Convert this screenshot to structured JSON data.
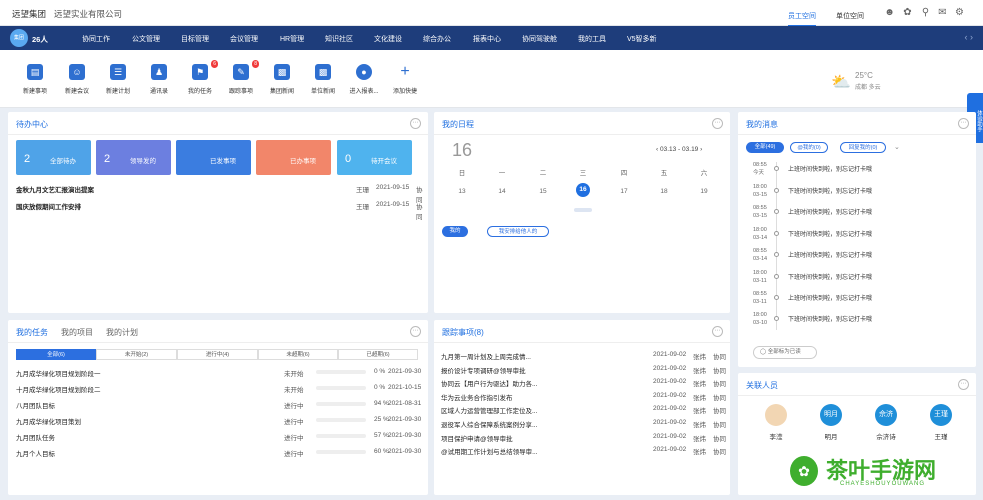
{
  "topbar": {
    "brand": "远望集团",
    "company": "远望实业有限公司",
    "spaces": [
      "员工空间",
      "单位空间"
    ]
  },
  "nav": {
    "avatar_text": "集团",
    "count": "26人",
    "items": [
      "协同工作",
      "公文管理",
      "目标管理",
      "会议管理",
      "HR管理",
      "知识社区",
      "文化建设",
      "综合办公",
      "报表中心",
      "协同驾驶舱",
      "我的工具",
      "V5智多新"
    ]
  },
  "quick": [
    {
      "label": "新建事项",
      "icon": "new-item-icon"
    },
    {
      "label": "新建会议",
      "icon": "meeting-icon"
    },
    {
      "label": "新建计划",
      "icon": "plan-icon"
    },
    {
      "label": "通讯录",
      "icon": "contacts-icon"
    },
    {
      "label": "我的任务",
      "icon": "task-icon",
      "badge": "6"
    },
    {
      "label": "跟踪事项",
      "icon": "track-icon",
      "badge": "8"
    },
    {
      "label": "集团新闻",
      "icon": "news-icon"
    },
    {
      "label": "单位新闻",
      "icon": "unit-news-icon"
    },
    {
      "label": "进入报表...",
      "icon": "report-icon"
    },
    {
      "label": "添加快捷",
      "icon": "plus-icon"
    }
  ],
  "weather": {
    "temp": "25°C",
    "loc": "成都 多云"
  },
  "todo": {
    "title": "待办中心",
    "cards": [
      {
        "num": "2",
        "label": "全部待办",
        "color": "#4fa3e8"
      },
      {
        "num": "2",
        "label": "领导发的",
        "color": "#6c7fe0"
      },
      {
        "num": "",
        "label": "已发事项",
        "color": "#3b7de0"
      },
      {
        "num": "",
        "label": "已办事项",
        "color": "#f2866a"
      },
      {
        "num": "0",
        "label": "待开会议",
        "color": "#4fb3ee"
      }
    ],
    "rows": [
      {
        "title": "金秋九月文艺汇报演出提案",
        "user": "王珊",
        "date": "2021-09-15",
        "cat": "协同"
      },
      {
        "title": "国庆放假期间工作安排",
        "user": "王珊",
        "date": "2021-09-15",
        "cat": "协同"
      }
    ]
  },
  "schedule": {
    "title": "我的日程",
    "today": "16",
    "range": "03.13 - 03.19",
    "weekdays": [
      "日",
      "一",
      "二",
      "三",
      "四",
      "五",
      "六"
    ],
    "days": [
      "13",
      "14",
      "15",
      "16",
      "17",
      "18",
      "19"
    ],
    "selected_index": 3,
    "tabs": [
      "我的",
      "我安排给他人的"
    ]
  },
  "messages": {
    "title": "我的消息",
    "tabs": [
      "全部(49)",
      "@我的(0)",
      "回复我的(0)"
    ],
    "items": [
      {
        "time": "08:55",
        "date": "今天",
        "text": "上班时间快到啦，别忘记打卡哦"
      },
      {
        "time": "18:00",
        "date": "03-15",
        "text": "下班时间快到啦，别忘记打卡哦"
      },
      {
        "time": "08:55",
        "date": "03-15",
        "text": "上班时间快到啦，别忘记打卡哦"
      },
      {
        "time": "18:00",
        "date": "03-14",
        "text": "下班时间快到啦，别忘记打卡哦"
      },
      {
        "time": "08:55",
        "date": "03-14",
        "text": "上班时间快到啦，别忘记打卡哦"
      },
      {
        "time": "18:00",
        "date": "03-11",
        "text": "下班时间快到啦，别忘记打卡哦"
      },
      {
        "time": "08:55",
        "date": "03-11",
        "text": "上班时间快到啦，别忘记打卡哦"
      },
      {
        "time": "18:00",
        "date": "03-10",
        "text": "下班时间快到啦，别忘记打卡哦"
      }
    ],
    "mark_read": "全部标为已读"
  },
  "tasks": {
    "tabs": [
      "我的任务",
      "我的项目",
      "我的计划"
    ],
    "filters": [
      "全部(6)",
      "未开始(2)",
      "进行中(4)",
      "未超期(6)",
      "已超期(6)"
    ],
    "rows": [
      {
        "title": "九月成华绿化项目规划阶段一",
        "status": "未开始",
        "progress": 0,
        "pct": "0 %",
        "date": "2021-09-30"
      },
      {
        "title": "十月成华绿化项目规划阶段二",
        "status": "未开始",
        "progress": 0,
        "pct": "0 %",
        "date": "2021-10-15"
      },
      {
        "title": "八月团队目标",
        "status": "进行中",
        "progress": 94,
        "pct": "94 %",
        "date": "2021-08-31"
      },
      {
        "title": "九月成华绿化项目策划",
        "status": "进行中",
        "progress": 25,
        "pct": "25 %",
        "date": "2021-09-30"
      },
      {
        "title": "九月团队任务",
        "status": "进行中",
        "progress": 57,
        "pct": "57 %",
        "date": "2021-09-30"
      },
      {
        "title": "九月个人目标",
        "status": "进行中",
        "progress": 60,
        "pct": "60 %",
        "date": "2021-09-30"
      }
    ]
  },
  "tracking": {
    "title": "跟踪事项(8)",
    "rows": [
      {
        "title": "九月第一周计划及上周完成情...",
        "date": "2021-09-02",
        "user": "张炜",
        "cat": "协同"
      },
      {
        "title": "报价设计专项调研@领导审批",
        "date": "2021-09-02",
        "user": "张炜",
        "cat": "协同"
      },
      {
        "title": "协同云【用户行为驱达】助力各...",
        "date": "2021-09-02",
        "user": "张炜",
        "cat": "协同"
      },
      {
        "title": "华为云业务合作指引发布",
        "date": "2021-09-02",
        "user": "张炜",
        "cat": "协同"
      },
      {
        "title": "区域人力运营管理部工作定位及...",
        "date": "2021-09-02",
        "user": "张炜",
        "cat": "协同"
      },
      {
        "title": "退役军人综合保障系统案例分享...",
        "date": "2021-09-02",
        "user": "张炜",
        "cat": "协同"
      },
      {
        "title": "项目保护申请@领导审批",
        "date": "2021-09-02",
        "user": "张炜",
        "cat": "协同"
      },
      {
        "title": "@试用期工作计划与总结领导审...",
        "date": "2021-09-02",
        "user": "张炜",
        "cat": "协同"
      }
    ]
  },
  "people": {
    "title": "关联人员",
    "items": [
      {
        "avatar": "",
        "name": "李滢"
      },
      {
        "avatar": "明月",
        "name": "明月"
      },
      {
        "avatar": "佘济",
        "name": "佘济诗"
      },
      {
        "avatar": "王瑾",
        "name": "王瑾"
      }
    ]
  },
  "sidetab": "体验助手",
  "watermark": {
    "title": "茶叶手游网",
    "sub": "CHAYESHOUYOUWANG"
  }
}
